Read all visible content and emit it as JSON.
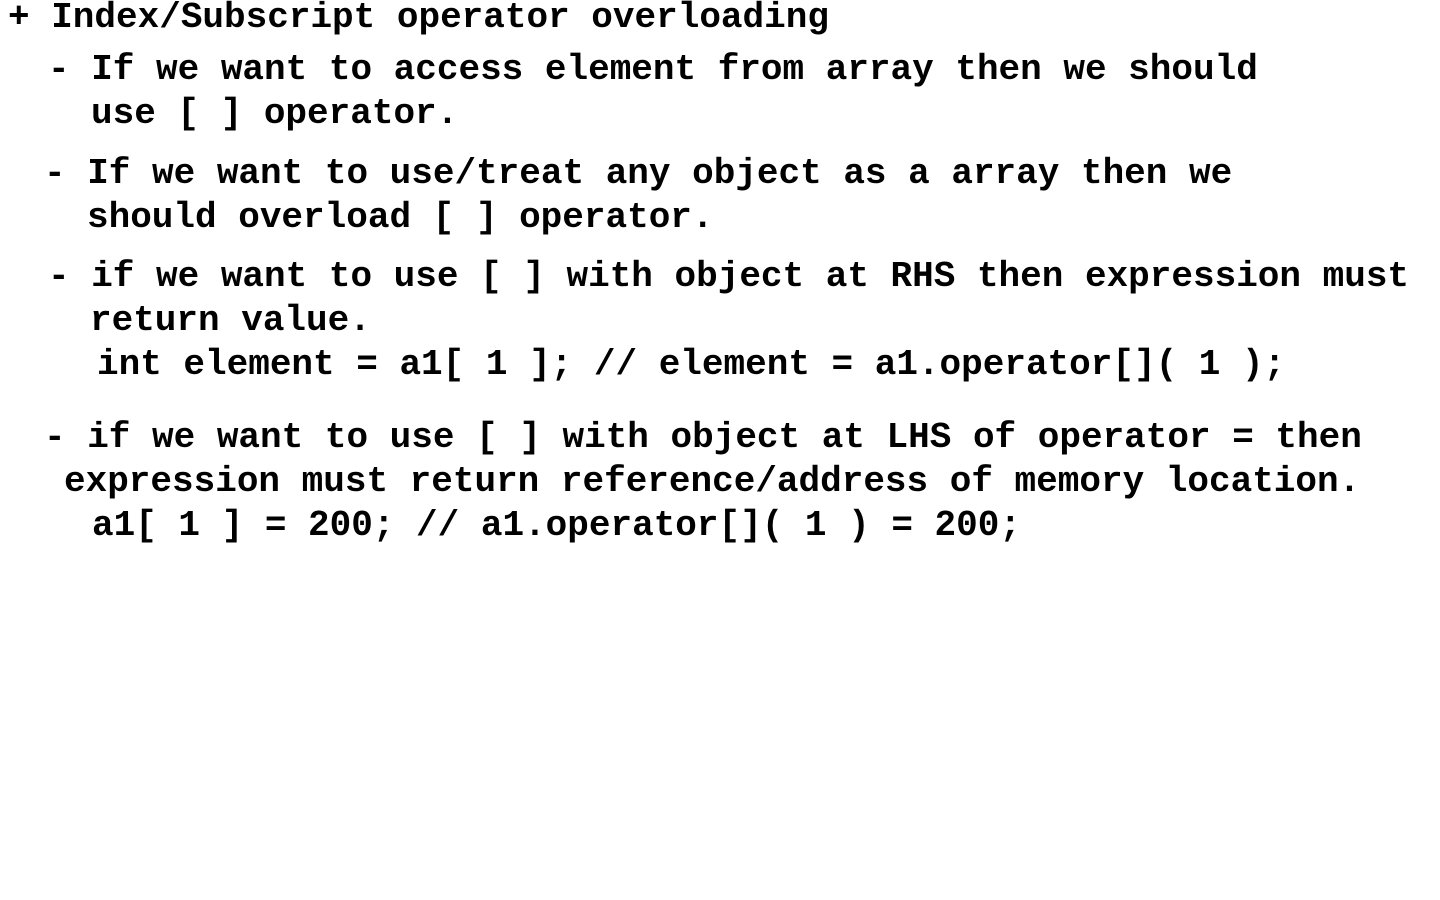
{
  "heading": "+ Index/Subscript operator overloading",
  "points": [
    {
      "lines": [
        "- If we want to access element from array then we should",
        "use [ ] operator."
      ]
    },
    {
      "lines": [
        "- If we want to use/treat any object as a array then we",
        "should overload [ ] operator."
      ]
    },
    {
      "lines": [
        "- if we want to use [ ] with object at RHS then expression must",
        "return value."
      ],
      "code": "int element = a1[ 1 ]; // element = a1.operator[]( 1 );"
    },
    {
      "lines": [
        "- if we want to use [ ] with object at LHS of operator = then",
        "expression must return reference/address of memory location."
      ],
      "code": "a1[ 1 ] = 200; // a1.operator[]( 1 ) = 200;"
    }
  ]
}
